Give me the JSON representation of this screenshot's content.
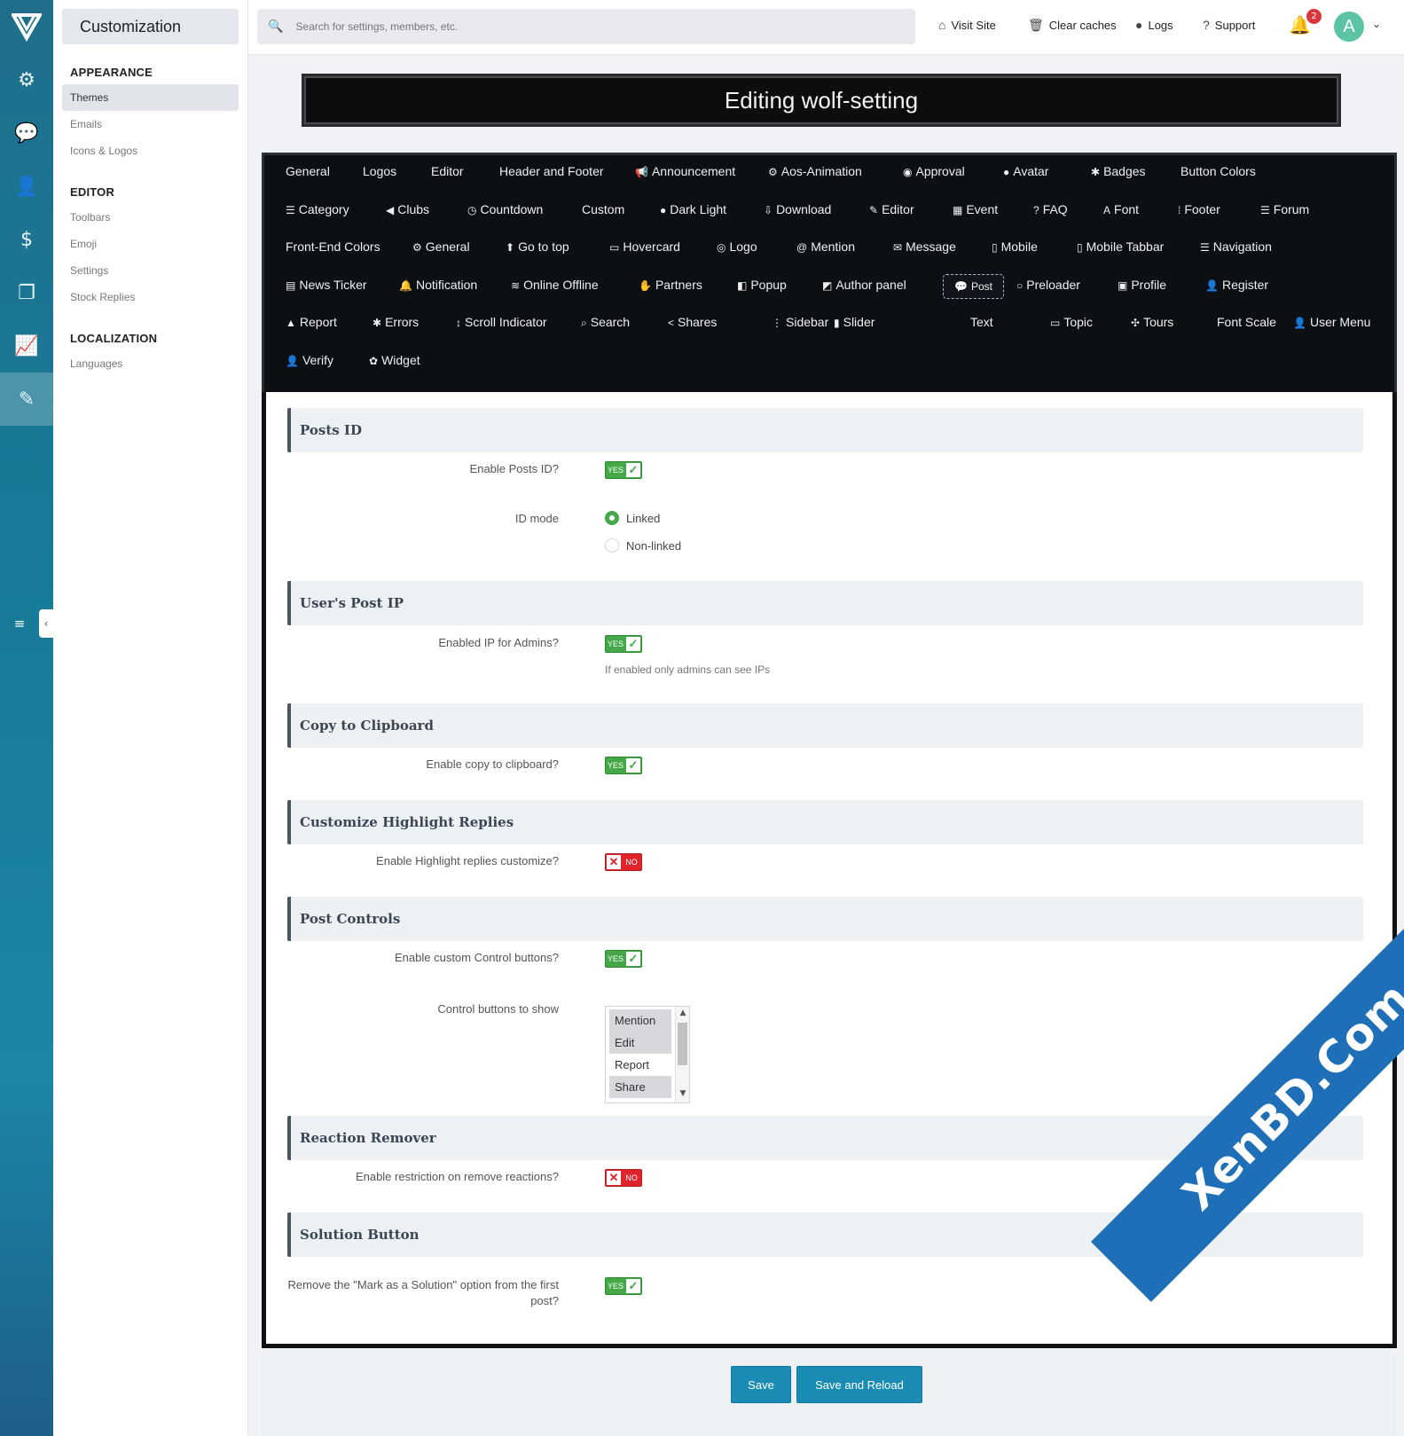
{
  "topbar": {
    "search_placeholder": "Search for settings, members, etc.",
    "links": [
      "Visit Site",
      "Clear caches",
      "Logs",
      "Support"
    ],
    "notification_count": "2",
    "avatar_initial": "A"
  },
  "subnav": {
    "title": "Customization",
    "appearance": {
      "heading": "APPEARANCE",
      "items": [
        "Themes",
        "Emails",
        "Icons & Logos"
      ]
    },
    "editor": {
      "heading": "EDITOR",
      "items": [
        "Toolbars",
        "Emoji",
        "Settings",
        "Stock Replies"
      ]
    },
    "localization": {
      "heading": "LOCALIZATION",
      "items": [
        "Languages"
      ]
    }
  },
  "page": {
    "title": "Editing wolf-setting"
  },
  "tabs": [
    "General",
    "Logos",
    "Editor",
    "Header and Footer",
    "Announcement",
    "Aos-Animation",
    "Approval",
    "Avatar",
    "Badges",
    "Button Colors",
    "Category",
    "Clubs",
    "Countdown",
    "Custom",
    "Dark Light",
    "Download",
    "Editor",
    "Event",
    "FAQ",
    "Font",
    "Footer",
    "Forum",
    "Front-End Colors",
    "General",
    "Go to top",
    "Hovercard",
    "Logo",
    "Mention",
    "Message",
    "Mobile",
    "Mobile Tabbar",
    "Navigation",
    "News Ticker",
    "Notification",
    "Online Offline",
    "Partners",
    "Popup",
    "Author panel",
    "Post",
    "Preloader",
    "Profile",
    "Register",
    "Report",
    "Errors",
    "Scroll Indicator",
    "Search",
    "Shares",
    "Sidebar",
    "Slider",
    "Text",
    "Topic",
    "Tours",
    "Font Scale",
    "User Menu",
    "Verify",
    "Widget"
  ],
  "active_tab": "Post",
  "form": {
    "posts_id": {
      "heading": "Posts ID",
      "enable_label": "Enable Posts ID?",
      "enable_value": "YES",
      "mode_label": "ID mode",
      "mode_options": [
        "Linked",
        "Non-linked"
      ],
      "mode_selected": "Linked"
    },
    "user_ip": {
      "heading": "User's Post IP",
      "enable_label": "Enabled IP for Admins?",
      "enable_value": "YES",
      "hint": "If enabled only admins can see IPs"
    },
    "clipboard": {
      "heading": "Copy to Clipboard",
      "enable_label": "Enable copy to clipboard?",
      "enable_value": "YES"
    },
    "highlight": {
      "heading": "Customize Highlight Replies",
      "enable_label": "Enable Highlight replies customize?",
      "enable_value": "NO"
    },
    "controls": {
      "heading": "Post Controls",
      "enable_label": "Enable custom Control buttons?",
      "enable_value": "YES",
      "show_label": "Control buttons to show",
      "options": [
        "Mention",
        "Edit",
        "Report",
        "Share"
      ],
      "selected": [
        "Mention",
        "Edit",
        "Share"
      ]
    },
    "reaction": {
      "heading": "Reaction Remover",
      "enable_label": "Enable restriction on remove reactions?",
      "enable_value": "NO"
    },
    "solution": {
      "heading": "Solution Button",
      "enable_label": "Remove the \"Mark as a Solution\" option from the first post?",
      "enable_value": "YES"
    }
  },
  "buttons": {
    "save": "Save",
    "save_reload": "Save and Reload"
  },
  "watermark": "XenBD.Com",
  "colors": {
    "rail": "#177b97",
    "accent": "#1a8cb3",
    "yes": "#44a848",
    "no": "#e0242c"
  }
}
